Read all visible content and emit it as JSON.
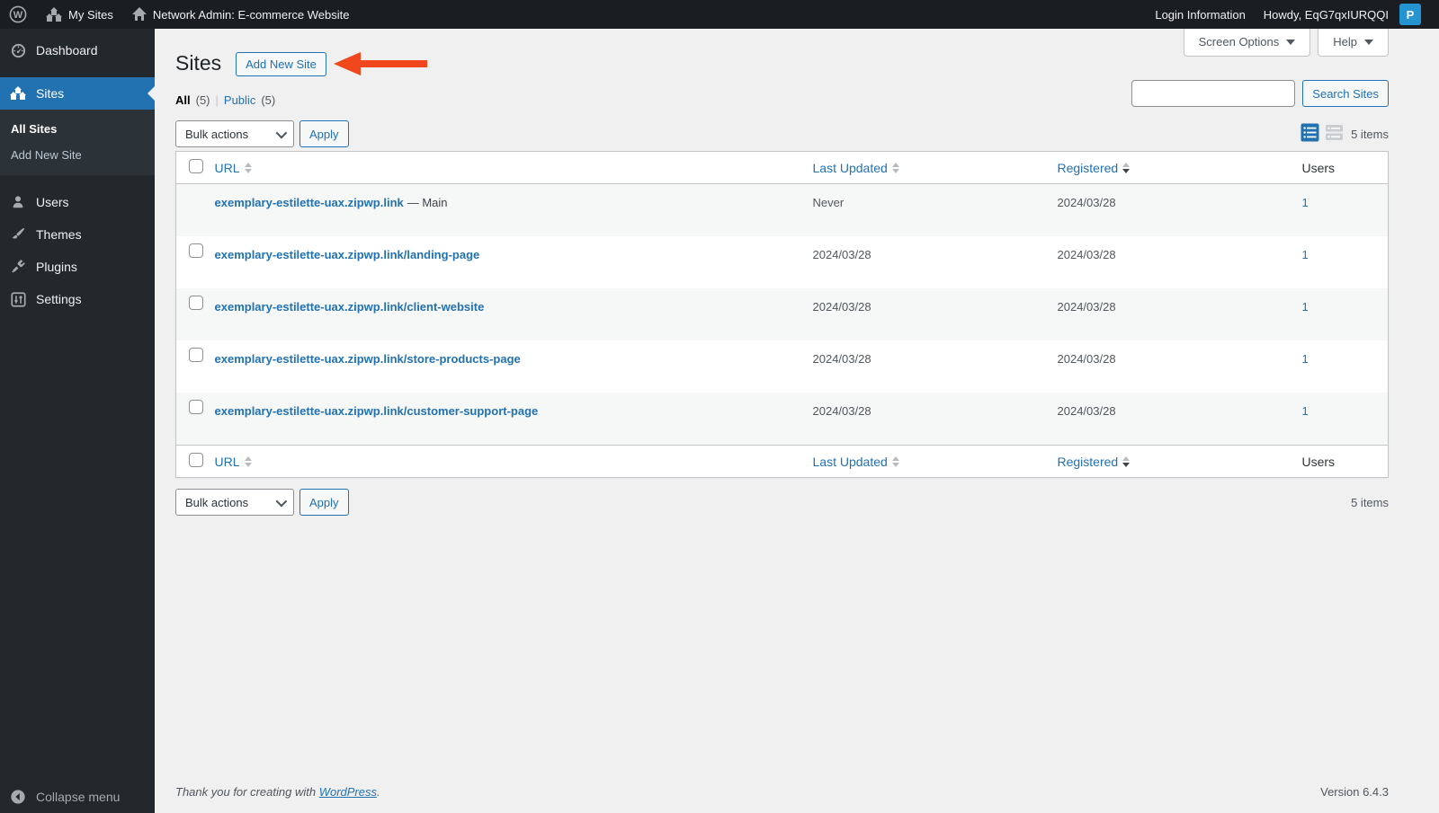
{
  "admin_bar": {
    "my_sites": "My Sites",
    "network_title": "Network Admin: E-commerce Website",
    "login_information": "Login Information",
    "howdy": "Howdy, EqG7qxIURQQI",
    "avatar_letter": "P"
  },
  "sidebar": {
    "dashboard": "Dashboard",
    "sites": "Sites",
    "all_sites": "All Sites",
    "add_new_site": "Add New Site",
    "users": "Users",
    "themes": "Themes",
    "plugins": "Plugins",
    "settings": "Settings",
    "collapse_menu": "Collapse menu"
  },
  "screen_meta": {
    "screen_options": "Screen Options",
    "help": "Help"
  },
  "page": {
    "title": "Sites",
    "add_new_button": "Add New Site",
    "filters": {
      "all_label": "All",
      "all_count": "(5)",
      "separator": "|",
      "public_label": "Public",
      "public_count": "(5)"
    },
    "search": {
      "placeholder": "",
      "button": "Search Sites"
    },
    "bulk_actions_label": "Bulk actions",
    "apply_label": "Apply",
    "items_count": "5 items"
  },
  "table": {
    "columns": {
      "url": "URL",
      "last_updated": "Last Updated",
      "registered": "Registered",
      "users": "Users"
    },
    "rows": [
      {
        "url": "exemplary-estilette-uax.zipwp.link",
        "suffix": "— Main",
        "last_updated": "Never",
        "registered": "2024/03/28",
        "users": "1"
      },
      {
        "url": "exemplary-estilette-uax.zipwp.link/landing-page",
        "suffix": "",
        "last_updated": "2024/03/28",
        "registered": "2024/03/28",
        "users": "1"
      },
      {
        "url": "exemplary-estilette-uax.zipwp.link/client-website",
        "suffix": "",
        "last_updated": "2024/03/28",
        "registered": "2024/03/28",
        "users": "1"
      },
      {
        "url": "exemplary-estilette-uax.zipwp.link/store-products-page",
        "suffix": "",
        "last_updated": "2024/03/28",
        "registered": "2024/03/28",
        "users": "1"
      },
      {
        "url": "exemplary-estilette-uax.zipwp.link/customer-support-page",
        "suffix": "",
        "last_updated": "2024/03/28",
        "registered": "2024/03/28",
        "users": "1"
      }
    ]
  },
  "footer": {
    "thankyou_prefix": "Thank you for creating with ",
    "wordpress_link": "WordPress",
    "thankyou_suffix": ".",
    "version": "Version 6.4.3"
  },
  "colors": {
    "accent_blue": "#2271b1",
    "annotation_arrow": "#f1471d",
    "adminbar_bg": "#1a1e23",
    "sidebar_bg": "#23282d",
    "active_menu_bg": "#2271b1",
    "alt_row_bg": "#f6f7f7",
    "avatar_bg": "#2595d1"
  }
}
